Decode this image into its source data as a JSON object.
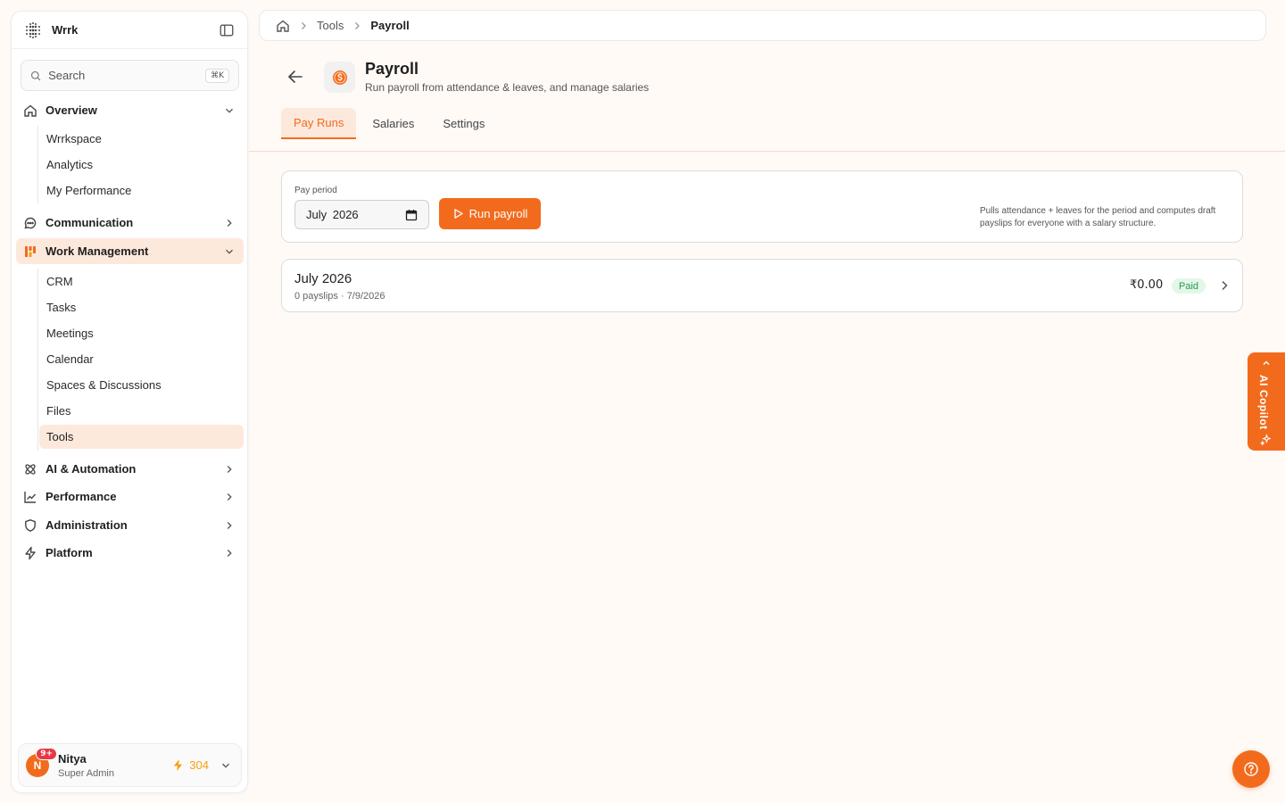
{
  "app": {
    "brand": "Wrrk"
  },
  "search": {
    "placeholder": "Search",
    "shortcut": "⌘K"
  },
  "sidebar": {
    "groups": [
      {
        "label": "Overview",
        "icon": "home-icon",
        "expanded": true,
        "items": [
          "Wrrkspace",
          "Analytics",
          "My Performance"
        ]
      },
      {
        "label": "Communication",
        "icon": "chat-icon",
        "expanded": false
      },
      {
        "label": "Work Management",
        "icon": "grid-icon",
        "expanded": true,
        "active": true,
        "items": [
          "CRM",
          "Tasks",
          "Meetings",
          "Calendar",
          "Spaces & Discussions",
          "Files",
          "Tools"
        ]
      },
      {
        "label": "AI & Automation",
        "icon": "atom-icon",
        "expanded": false
      },
      {
        "label": "Performance",
        "icon": "chart-line-icon",
        "expanded": false
      },
      {
        "label": "Administration",
        "icon": "shield-icon",
        "expanded": false
      },
      {
        "label": "Platform",
        "icon": "bolt-icon",
        "expanded": false
      }
    ],
    "active_item": "Tools"
  },
  "profile": {
    "initial": "N",
    "badge": "9+",
    "name": "Nitya",
    "role": "Super Admin",
    "points": "304"
  },
  "breadcrumb": {
    "items": [
      "Tools",
      "Payroll"
    ]
  },
  "page": {
    "title": "Payroll",
    "subtitle": "Run payroll from attendance & leaves, and manage salaries",
    "tabs": [
      "Pay Runs",
      "Salaries",
      "Settings"
    ],
    "active_tab": "Pay Runs"
  },
  "pay_period": {
    "label": "Pay period",
    "value": "July 2026",
    "run_button": "Run payroll",
    "note": "Pulls attendance + leaves for the period and computes draft payslips for everyone with a salary structure."
  },
  "runs": [
    {
      "title": "July 2026",
      "meta": "0 payslips · 7/9/2026",
      "amount": "₹0.00",
      "status": "Paid"
    }
  ],
  "copilot": {
    "label": "AI Copilot"
  },
  "colors": {
    "accent": "#f26b1d",
    "accent_soft": "#fde9dc",
    "success": "#2a9a4b"
  }
}
